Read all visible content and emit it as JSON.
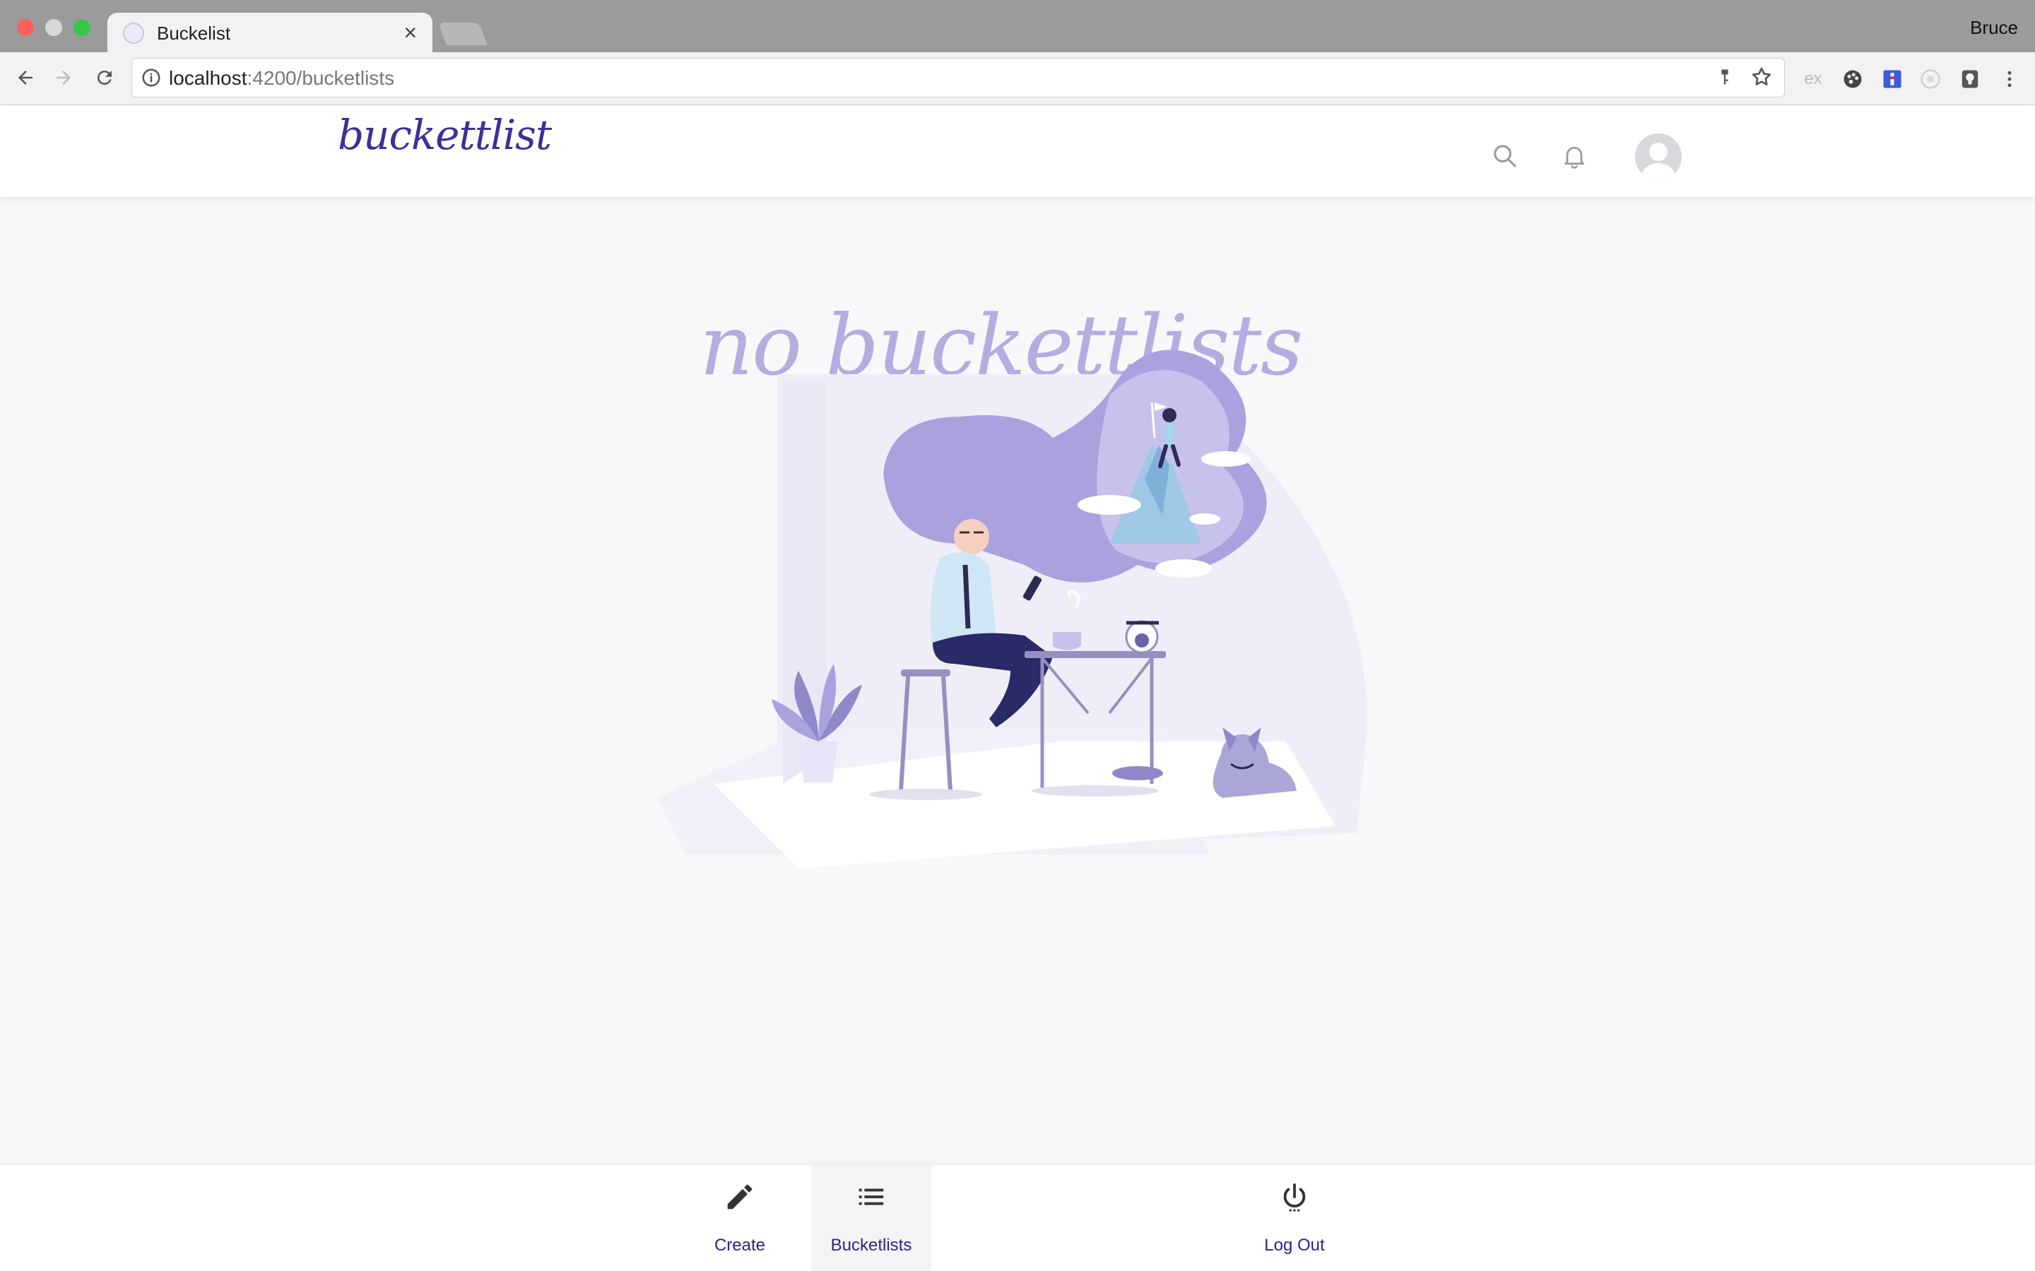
{
  "browser": {
    "tab_title": "Buckelist",
    "profile_name": "Bruce",
    "url_host": "localhost",
    "url_path": ":4200/bucketlists",
    "extension_ex_label": "ex"
  },
  "header": {
    "logo": "buckettlist"
  },
  "main": {
    "empty_title": "no buckettlists"
  },
  "bottom_nav": {
    "items": [
      {
        "label": "Create",
        "icon": "pencil-icon"
      },
      {
        "label": "Bucketlists",
        "icon": "list-icon",
        "active": true
      },
      {
        "label": "Log Out",
        "icon": "power-icon"
      }
    ]
  },
  "colors": {
    "accent": "#2c2487",
    "illustration": "#b3ade0"
  }
}
